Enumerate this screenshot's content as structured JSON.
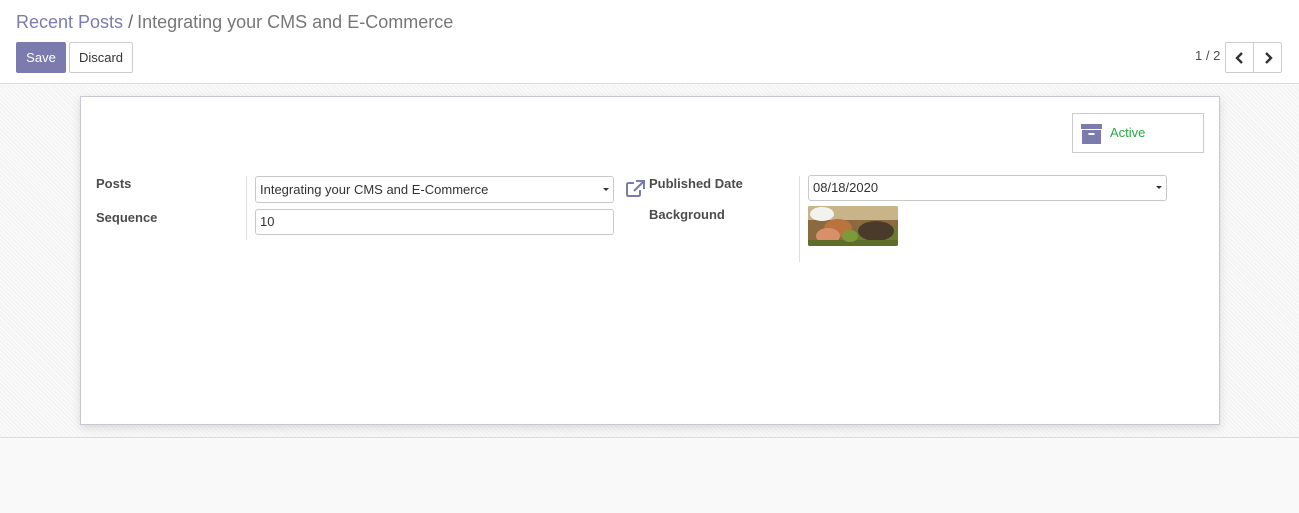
{
  "breadcrumb": {
    "parent": "Recent Posts",
    "separator": "/",
    "current": "Integrating your CMS and E-Commerce"
  },
  "toolbar": {
    "save_label": "Save",
    "discard_label": "Discard"
  },
  "pager": {
    "value": "1 / 2",
    "prev_icon": "chevron-left-icon",
    "next_icon": "chevron-right-icon"
  },
  "status": {
    "active_label": "Active",
    "icon": "archive-icon",
    "color": "#28a745"
  },
  "form": {
    "posts_label": "Posts",
    "posts_value": "Integrating your CMS and E-Commerce",
    "sequence_label": "Sequence",
    "sequence_value": "10",
    "published_date_label": "Published Date",
    "published_date_value": "08/18/2020",
    "background_label": "Background",
    "external_link_icon": "external-link-icon"
  },
  "colors": {
    "primary": "#7c7bad",
    "success": "#28a745"
  }
}
